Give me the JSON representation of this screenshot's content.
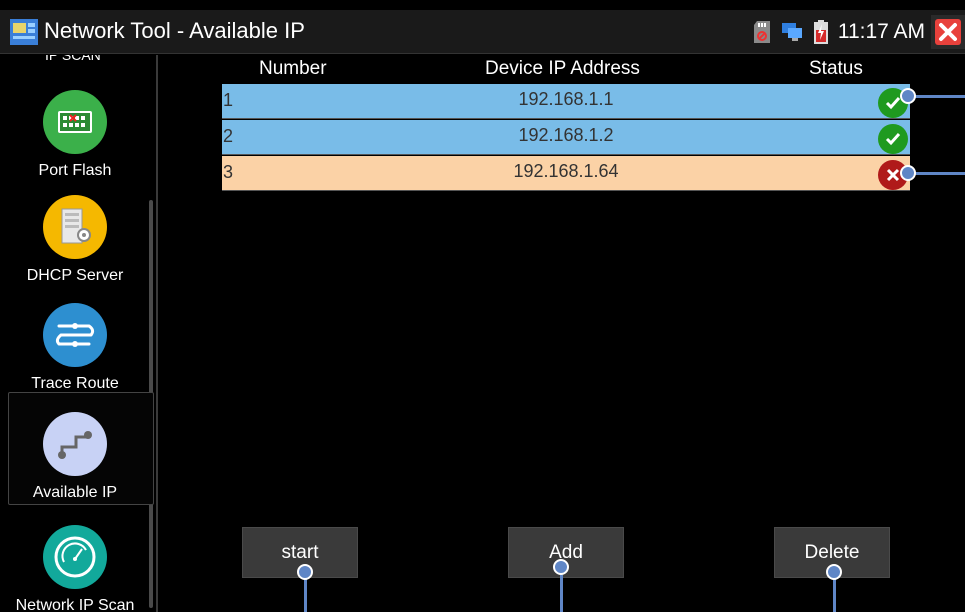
{
  "window": {
    "title": "Network Tool - Available IP",
    "clock": "11:17 AM"
  },
  "status_icons": [
    "sd-card-icon",
    "network-icon",
    "battery-icon"
  ],
  "sidebar": {
    "cut_label": "IP SCAN",
    "items": [
      {
        "label": "Port Flash",
        "icon": "port-flash-icon",
        "color": "#3bb04a"
      },
      {
        "label": "DHCP Server",
        "icon": "dhcp-server-icon",
        "color": "#f5b800"
      },
      {
        "label": "Trace Route",
        "icon": "trace-route-icon",
        "color": "#2d8fd0"
      },
      {
        "label": "Available IP",
        "icon": "available-ip-icon",
        "color": "#c8d2f5",
        "selected": true
      },
      {
        "label": "Network IP Scan",
        "icon": "network-ip-scan-icon",
        "color": "#12a99b"
      }
    ]
  },
  "table": {
    "headers": {
      "number": "Number",
      "ip": "Device IP Address",
      "status": "Status"
    },
    "rows": [
      {
        "number": "1",
        "ip": "192.168.1.1",
        "status": "available",
        "color": "#79bce8"
      },
      {
        "number": "2",
        "ip": "192.168.1.2",
        "status": "available",
        "color": "#79bce8"
      },
      {
        "number": "3",
        "ip": "192.168.1.64",
        "status": "occupied",
        "color": "#fbd2a6"
      }
    ]
  },
  "buttons": {
    "start": "start",
    "add": "Add",
    "delete": "Delete"
  },
  "colors": {
    "ok": "#1f9a1f",
    "fail": "#b01a1a",
    "callout": "#5f86c6",
    "close": "#e8413c"
  }
}
